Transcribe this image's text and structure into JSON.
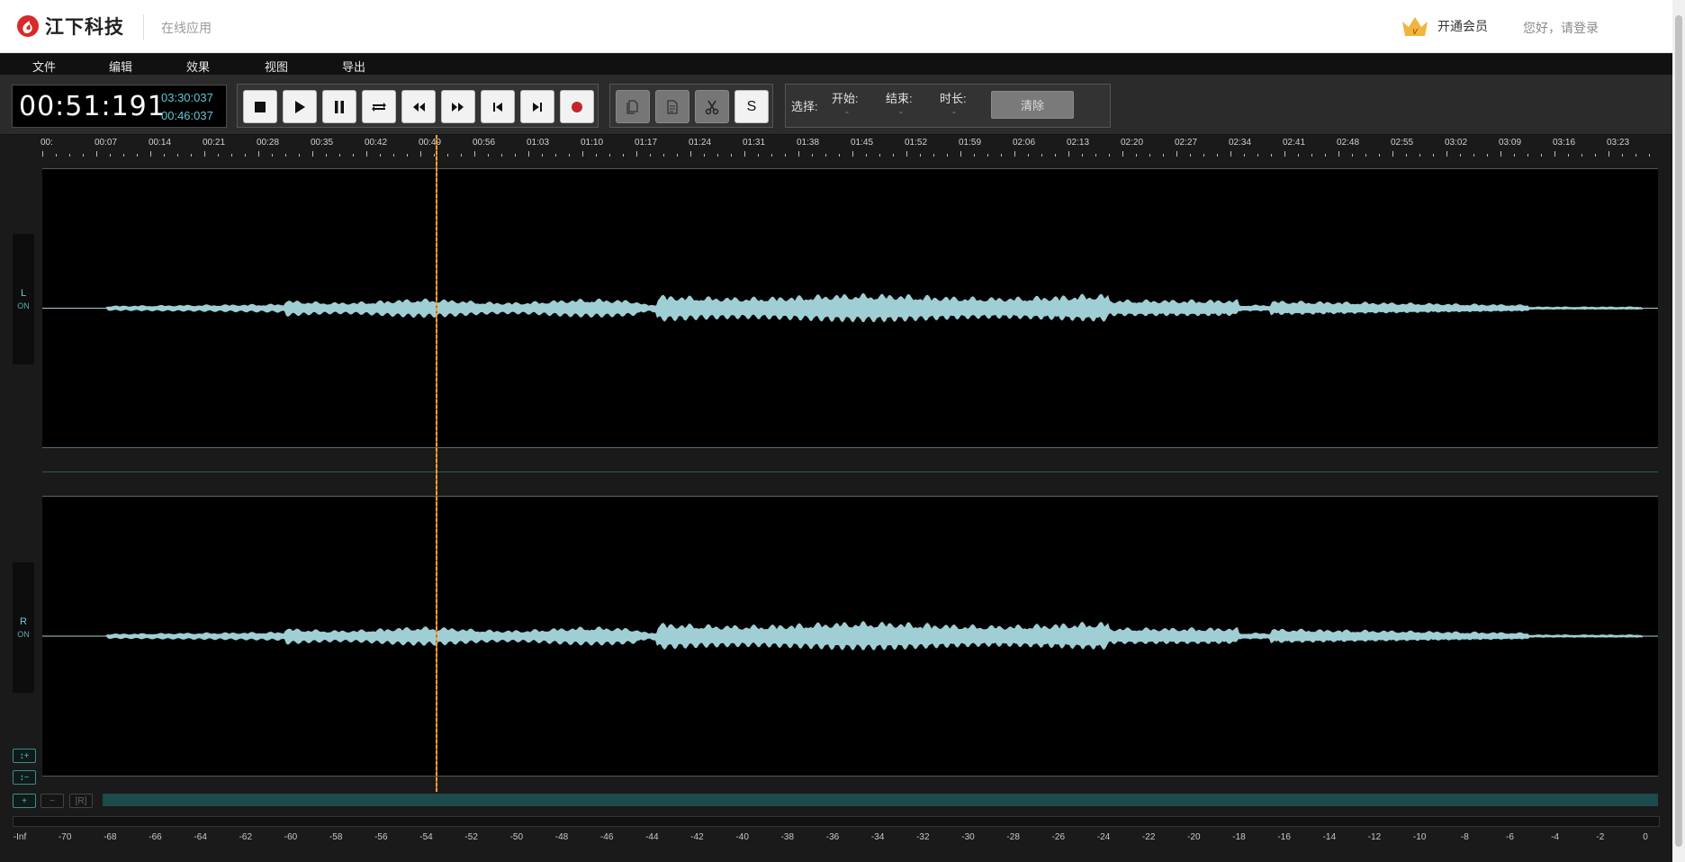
{
  "header": {
    "brand": "江下科技",
    "subtitle": "在线应用",
    "vip_label": "开通会员",
    "vip_icon_letter": "v",
    "login_label": "您好，请登录",
    "brand_color": "#d72a2a",
    "vip_color": "#f2b43a"
  },
  "menu": {
    "items": [
      "文件",
      "编辑",
      "效果",
      "视图",
      "导出"
    ]
  },
  "transport": {
    "current_time": "00:51:191",
    "total_time": "03:30:037",
    "selection_time": "00:46:037",
    "buttons": [
      "stop",
      "play",
      "pause",
      "loop",
      "rewind",
      "fast-forward",
      "skip-to-start",
      "skip-to-end",
      "record"
    ]
  },
  "edit_tools": {
    "buttons": [
      "copy",
      "paste",
      "cut",
      "silence"
    ],
    "silence_label": "S"
  },
  "selection": {
    "label": "选择:",
    "start_label": "开始:",
    "start_value": "-",
    "end_label": "结束:",
    "end_value": "-",
    "duration_label": "时长:",
    "duration_value": "-",
    "clear_label": "清除"
  },
  "timeline": {
    "labels": [
      "00:",
      "00:07",
      "00:14",
      "00:21",
      "00:28",
      "00:35",
      "00:42",
      "00:49",
      "00:56",
      "01:03",
      "01:10",
      "01:17",
      "01:24",
      "01:31",
      "01:38",
      "01:45",
      "01:52",
      "01:59",
      "02:06",
      "02:13",
      "02:20",
      "02:27",
      "02:34",
      "02:41",
      "02:48",
      "02:55",
      "03:02",
      "03:09",
      "03:16",
      "03:23"
    ]
  },
  "tracks": {
    "left": {
      "letter": "L",
      "state": "ON"
    },
    "right": {
      "letter": "R",
      "state": "ON"
    },
    "waveform_color": "#9fcfd4",
    "playhead_color": "#f2a23a"
  },
  "zoom_controls": {
    "v_zoom_in": "↕+",
    "v_zoom_out": "↕−",
    "h_zoom_in": "+",
    "h_zoom_out": "−",
    "reset": "[R]"
  },
  "meter": {
    "labels": [
      "-Inf",
      "-70",
      "-68",
      "-66",
      "-64",
      "-62",
      "-60",
      "-58",
      "-56",
      "-54",
      "-52",
      "-50",
      "-48",
      "-46",
      "-44",
      "-42",
      "-40",
      "-38",
      "-36",
      "-34",
      "-32",
      "-30",
      "-28",
      "-26",
      "-24",
      "-22",
      "-20",
      "-18",
      "-16",
      "-14",
      "-12",
      "-10",
      "-8",
      "-6",
      "-4",
      "-2",
      "0"
    ]
  }
}
